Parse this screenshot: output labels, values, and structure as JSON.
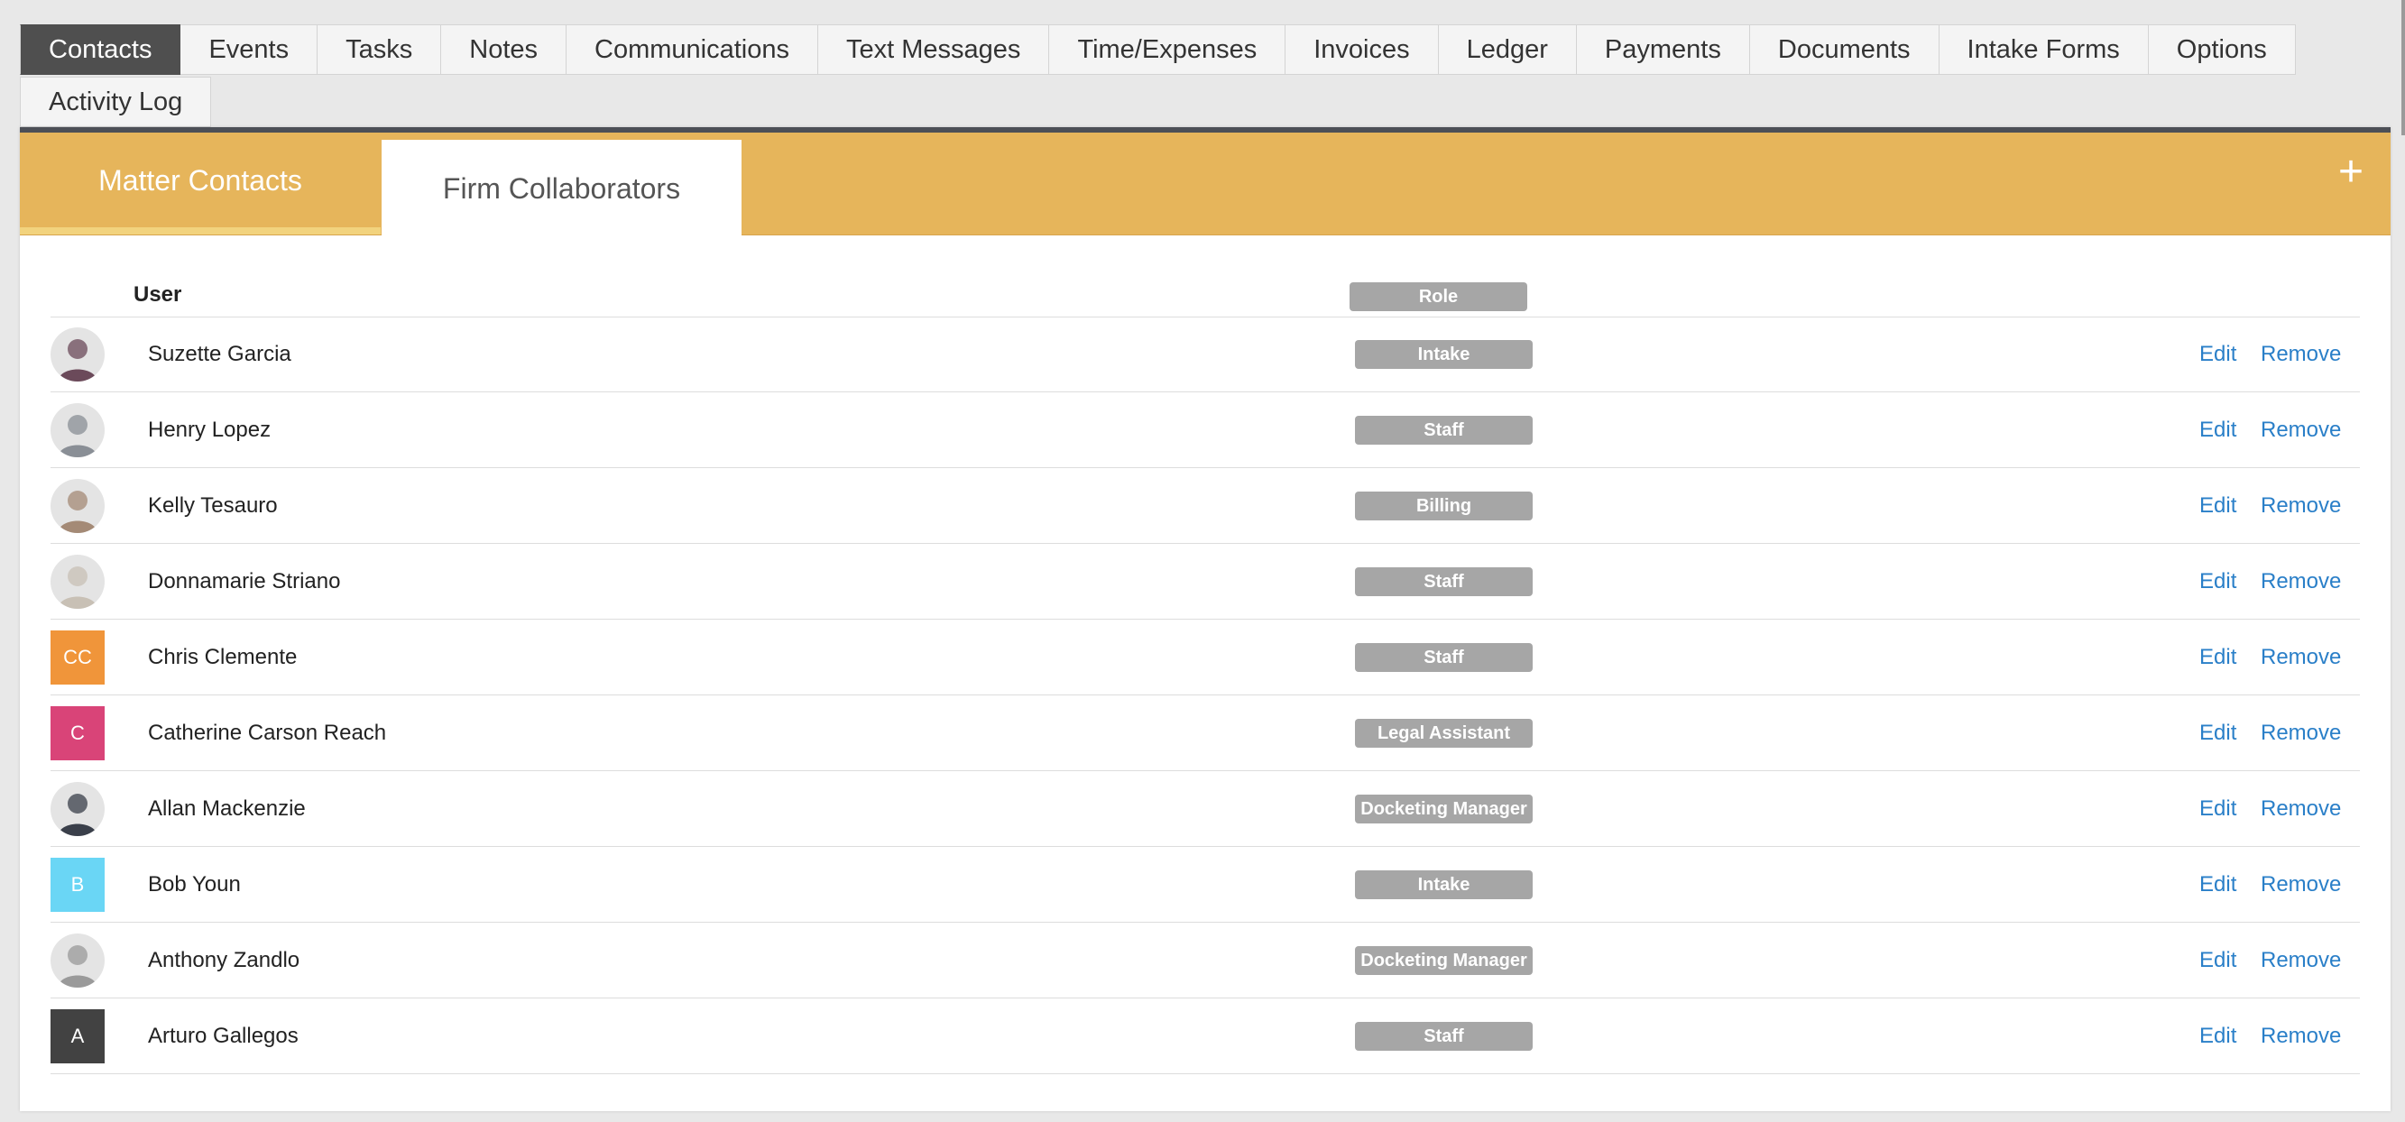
{
  "nav": {
    "tabs": [
      "Contacts",
      "Events",
      "Tasks",
      "Notes",
      "Communications",
      "Text Messages",
      "Time/Expenses",
      "Invoices",
      "Ledger",
      "Payments",
      "Documents",
      "Intake Forms",
      "Options"
    ],
    "tabs_row2": [
      "Activity Log"
    ],
    "active": "Contacts"
  },
  "subtabs": {
    "matter": "Matter Contacts",
    "firm": "Firm Collaborators",
    "add": "+"
  },
  "table": {
    "headers": {
      "user": "User",
      "role": "Role"
    },
    "edit_label": "Edit",
    "remove_label": "Remove",
    "rows": [
      {
        "name": "Suzette Garcia",
        "role": "Intake",
        "avatar": {
          "type": "photo",
          "color": "#6b4a5a"
        }
      },
      {
        "name": "Henry Lopez",
        "role": "Staff",
        "avatar": {
          "type": "photo",
          "color": "#8a8f96"
        }
      },
      {
        "name": "Kelly Tesauro",
        "role": "Billing",
        "avatar": {
          "type": "photo",
          "color": "#a48a76"
        }
      },
      {
        "name": "Donnamarie Striano",
        "role": "Staff",
        "avatar": {
          "type": "photo",
          "color": "#c8c0b5"
        }
      },
      {
        "name": "Chris Clemente",
        "role": "Staff",
        "avatar": {
          "type": "initials",
          "text": "CC",
          "color": "#f0953a"
        }
      },
      {
        "name": "Catherine Carson Reach",
        "role": "Legal Assistant",
        "avatar": {
          "type": "initials",
          "text": "C",
          "color": "#d94478"
        }
      },
      {
        "name": "Allan Mackenzie",
        "role": "Docketing Manager",
        "avatar": {
          "type": "photo",
          "color": "#3a3f4a"
        }
      },
      {
        "name": "Bob Youn",
        "role": "Intake",
        "avatar": {
          "type": "initials",
          "text": "B",
          "color": "#6ad6f5"
        }
      },
      {
        "name": "Anthony Zandlo",
        "role": "Docketing Manager",
        "avatar": {
          "type": "photo",
          "color": "#9a9a9a"
        }
      },
      {
        "name": "Arturo Gallegos",
        "role": "Staff",
        "avatar": {
          "type": "initials",
          "text": "A",
          "color": "#424242"
        }
      }
    ]
  },
  "colors": {
    "accent": "#e6b55b",
    "link": "#2a7fc8",
    "badge": "#a6a6a6",
    "active_tab": "#4f4f4f"
  }
}
